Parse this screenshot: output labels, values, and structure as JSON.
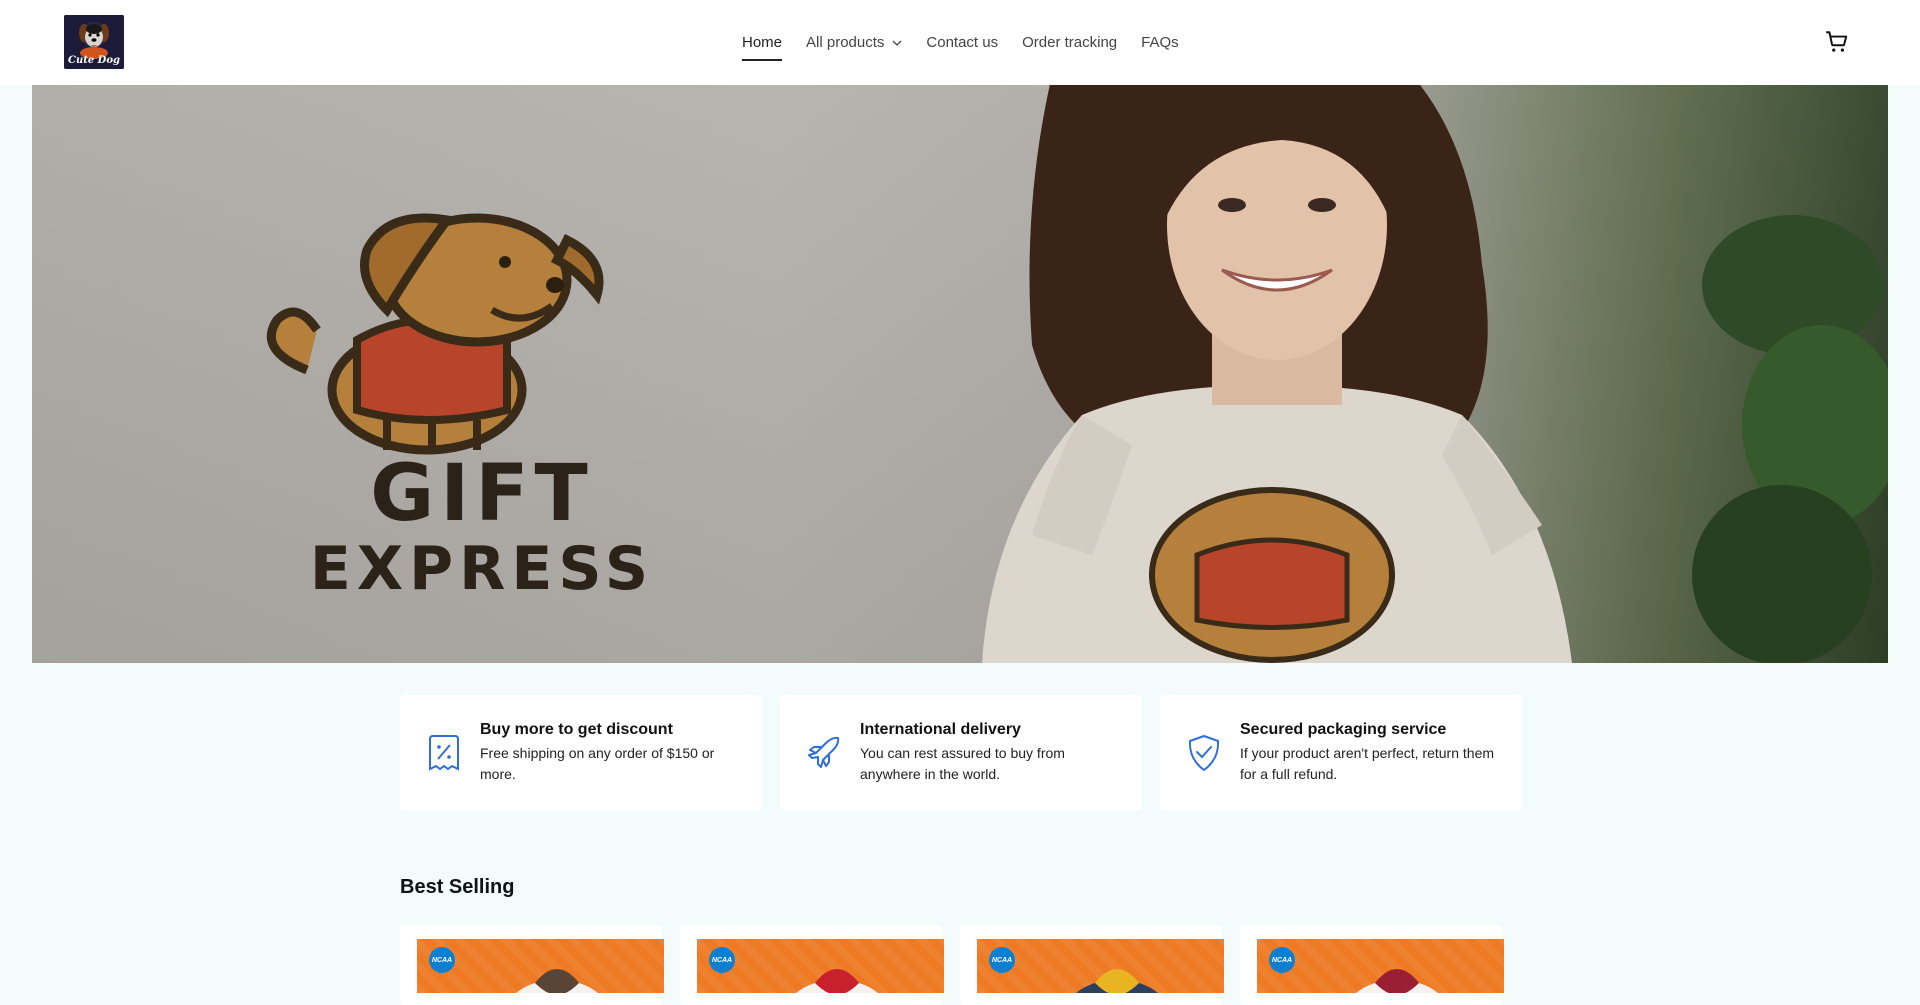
{
  "header": {
    "logo_text": "Cute Dog",
    "nav": [
      {
        "label": "Home",
        "active": true
      },
      {
        "label": "All products",
        "has_dropdown": true
      },
      {
        "label": "Contact us"
      },
      {
        "label": "Order tracking"
      },
      {
        "label": "FAQs"
      }
    ],
    "cart_icon": "shopping-cart-icon"
  },
  "hero": {
    "line1": "GIFT",
    "line2": "EXPRESS"
  },
  "features": [
    {
      "icon": "discount-tag-icon",
      "title": "Buy more to get discount",
      "desc": "Free shipping on any order of $150 or more."
    },
    {
      "icon": "airplane-icon",
      "title": "International delivery",
      "desc": "You can rest assured to buy from anywhere in the world."
    },
    {
      "icon": "shield-check-icon",
      "title": "Secured packaging service",
      "desc": "If your product aren't perfect, return them for a full refund."
    }
  ],
  "best_selling": {
    "title": "Best Selling",
    "products": [
      {
        "badge": "NCAA",
        "hood_color": "#5a4436"
      },
      {
        "badge": "NCAA",
        "hood_color": "#c8202c"
      },
      {
        "badge": "NCAA",
        "hood_color": "#e8b422"
      },
      {
        "badge": "NCAA",
        "hood_color": "#9a1f35"
      }
    ]
  },
  "colors": {
    "accent": "#2f6fd6",
    "page_bg": "#f4fbfb",
    "product_bg": "#ee7a24"
  }
}
